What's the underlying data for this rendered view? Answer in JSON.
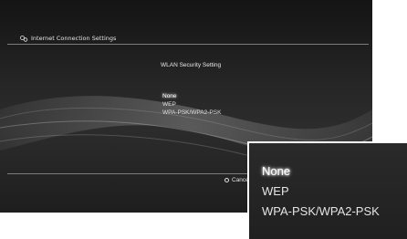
{
  "header": {
    "title": "Internet Connection Settings",
    "icon": "settings-gear-icon"
  },
  "dialog": {
    "title": "WLAN Security Setting",
    "options": [
      "None",
      "WEP",
      "WPA-PSK/WPA2-PSK"
    ],
    "selected": "None"
  },
  "footer": {
    "cancel_label": "Cancel",
    "cancel_icon": "circle-button-icon"
  },
  "zoom": {
    "options": [
      "None",
      "WEP",
      "WPA-PSK/WPA2-PSK"
    ],
    "selected": "None"
  }
}
